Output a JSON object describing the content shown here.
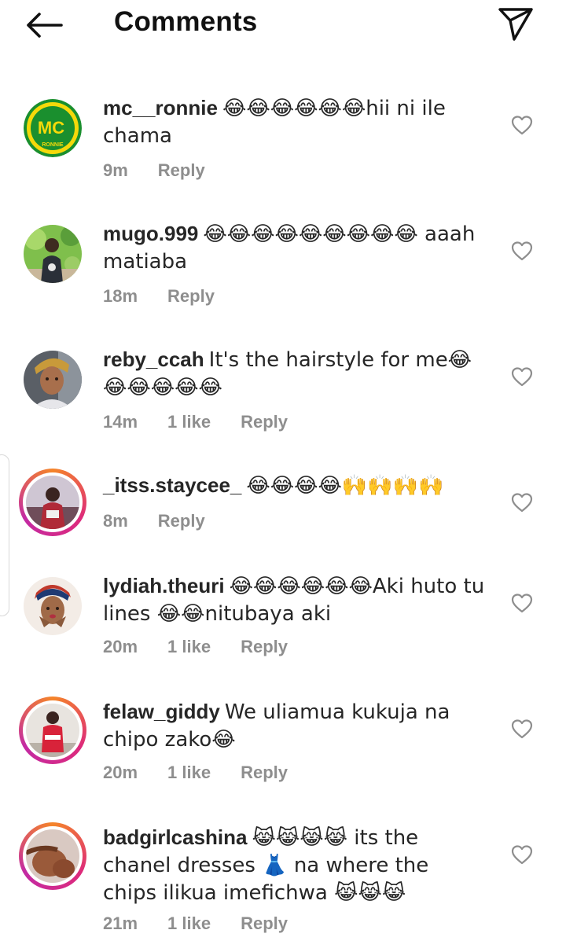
{
  "header": {
    "title": "Comments",
    "back_icon": "arrow-left-icon",
    "share_icon": "paper-plane-icon"
  },
  "reply_label": "Reply",
  "comments": [
    {
      "username": "mc__ronnie",
      "text": "😂😂😂😂😂😂hii ni ile chama",
      "time": "9m",
      "likes": "",
      "avatar": {
        "kind": "logo",
        "initials": "MC",
        "sub": "RONNIE"
      },
      "ring": false
    },
    {
      "username": "mugo.999",
      "text": "😂😂😂😂😂😂😂😂😂 aaah matiaba",
      "time": "18m",
      "likes": "",
      "avatar": {
        "kind": "photo"
      },
      "ring": false
    },
    {
      "username": "reby_ccah",
      "text": "It's the hairstyle for me😂😂😂😂😂😂",
      "time": "14m",
      "likes": "1 like",
      "avatar": {
        "kind": "photo"
      },
      "ring": false
    },
    {
      "username": "_itss.staycee_",
      "text": "😂😂😂😂🙌🙌🙌🙌",
      "time": "8m",
      "likes": "",
      "avatar": {
        "kind": "photo"
      },
      "ring": true
    },
    {
      "username": "lydiah.theuri",
      "text": "😂😂😂😂😂😂Aki huto tu lines 😂😂nitubaya aki",
      "time": "20m",
      "likes": "1 like",
      "avatar": {
        "kind": "photo"
      },
      "ring": false
    },
    {
      "username": "felaw_giddy",
      "text": "We uliamua kukuja na chipo zako😂",
      "time": "20m",
      "likes": "1 like",
      "avatar": {
        "kind": "photo"
      },
      "ring": true
    },
    {
      "username": "badgirlcashina",
      "text": "😹😹😹😹 its the chanel dresses 👗 na where the chips ilikua imefichwa 😹😹😹",
      "time": "21m",
      "likes": "1 like",
      "avatar": {
        "kind": "photo"
      },
      "ring": true
    }
  ],
  "colors": {
    "text": "#262626",
    "meta": "#8e8e8e",
    "logo_green": "#1a8f2e",
    "logo_yellow": "#f5d90a"
  }
}
